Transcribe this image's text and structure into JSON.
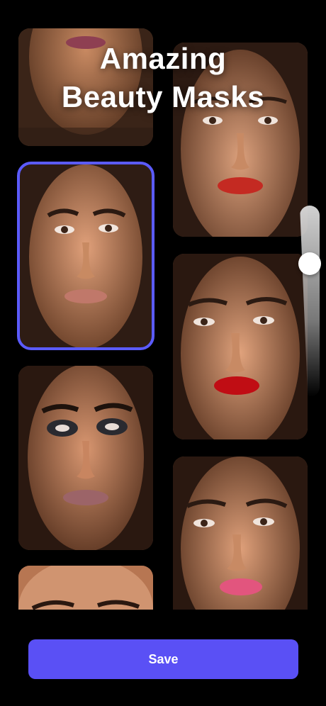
{
  "header": {
    "title_line1": "Amazing",
    "title_line2": "Beauty Masks"
  },
  "colors": {
    "accent": "#5a50f5",
    "selection": "#5b5bff",
    "background": "#000000"
  },
  "masks": [
    {
      "name": "mask-1",
      "selected": false
    },
    {
      "name": "mask-natural",
      "selected": true
    },
    {
      "name": "mask-smoky",
      "selected": false
    },
    {
      "name": "mask-partial",
      "selected": false
    },
    {
      "name": "mask-gloss-red",
      "selected": false
    },
    {
      "name": "mask-bold-red",
      "selected": false
    },
    {
      "name": "mask-pink",
      "selected": false
    }
  ],
  "slider": {
    "level": 0.25
  },
  "footer": {
    "save_label": "Save"
  }
}
